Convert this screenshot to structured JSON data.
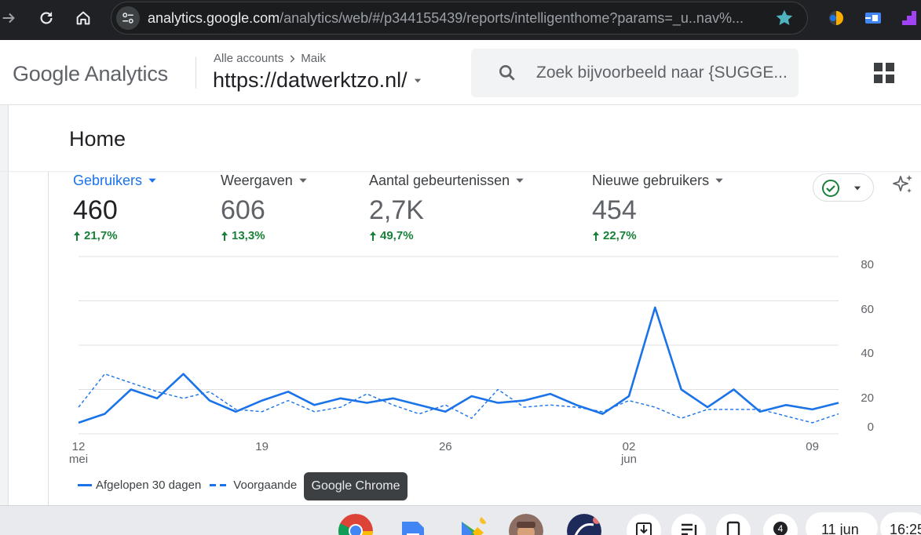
{
  "browser": {
    "url_host": "analytics.google.com",
    "url_path": "/analytics/web/#/p344155439/reports/intelligenthome?params=_u..nav%..."
  },
  "header": {
    "logo_text": "Google Analytics",
    "breadcrumb_all": "Alle accounts",
    "breadcrumb_account": "Maik",
    "property": "https://datwerktzo.nl/",
    "search_placeholder": "Zoek bijvoorbeeld naar {SUGGE..."
  },
  "page": {
    "title": "Home"
  },
  "metrics": [
    {
      "label": "Gebruikers",
      "value": "460",
      "change": "21,7%"
    },
    {
      "label": "Weergaven",
      "value": "606",
      "change": "13,3%"
    },
    {
      "label": "Aantal gebeurtenissen",
      "value": "2,7K",
      "change": "49,7%"
    },
    {
      "label": "Nieuwe gebruikers",
      "value": "454",
      "change": "22,7%"
    }
  ],
  "legend": {
    "current": "Afgelopen 30 dagen",
    "previous": "Voorgaande"
  },
  "tooltip": "Google Chrome",
  "colors": {
    "accent": "#1a73e8",
    "positive": "#188038"
  },
  "shelf": {
    "notification_count": "4",
    "date": "11 jun",
    "time": "16:25"
  },
  "chart_data": {
    "type": "line",
    "x": [
      "12 mei",
      "13 mei",
      "14 mei",
      "15 mei",
      "16 mei",
      "17 mei",
      "18 mei",
      "19 mei",
      "20 mei",
      "21 mei",
      "22 mei",
      "23 mei",
      "24 mei",
      "25 mei",
      "26 mei",
      "27 mei",
      "28 mei",
      "29 mei",
      "30 mei",
      "31 mei",
      "01 jun",
      "02 jun",
      "03 jun",
      "04 jun",
      "05 jun",
      "06 jun",
      "07 jun",
      "08 jun",
      "09 jun",
      "10 jun"
    ],
    "x_ticks": [
      {
        "day": "12",
        "month": "mei"
      },
      {
        "day": "19",
        "month": ""
      },
      {
        "day": "26",
        "month": ""
      },
      {
        "day": "02",
        "month": "jun"
      },
      {
        "day": "09",
        "month": ""
      }
    ],
    "y_ticks": [
      "0",
      "20",
      "40",
      "60",
      "80"
    ],
    "ylim": [
      0,
      80
    ],
    "series": [
      {
        "name": "Afgelopen 30 dagen",
        "style": "solid",
        "values": [
          5,
          9,
          20,
          16,
          27,
          15,
          10,
          15,
          19,
          13,
          16,
          14,
          16,
          13,
          10,
          17,
          14,
          15,
          18,
          13,
          9,
          17,
          57,
          20,
          12,
          20,
          10,
          13,
          11,
          14
        ]
      },
      {
        "name": "Voorgaande",
        "style": "dashed",
        "values": [
          12,
          27,
          23,
          19,
          16,
          19,
          11,
          10,
          15,
          10,
          12,
          18,
          13,
          9,
          13,
          7,
          20,
          12,
          13,
          12,
          10,
          15,
          12,
          7,
          11,
          11,
          11,
          8,
          5,
          9
        ]
      }
    ],
    "grid": true
  }
}
